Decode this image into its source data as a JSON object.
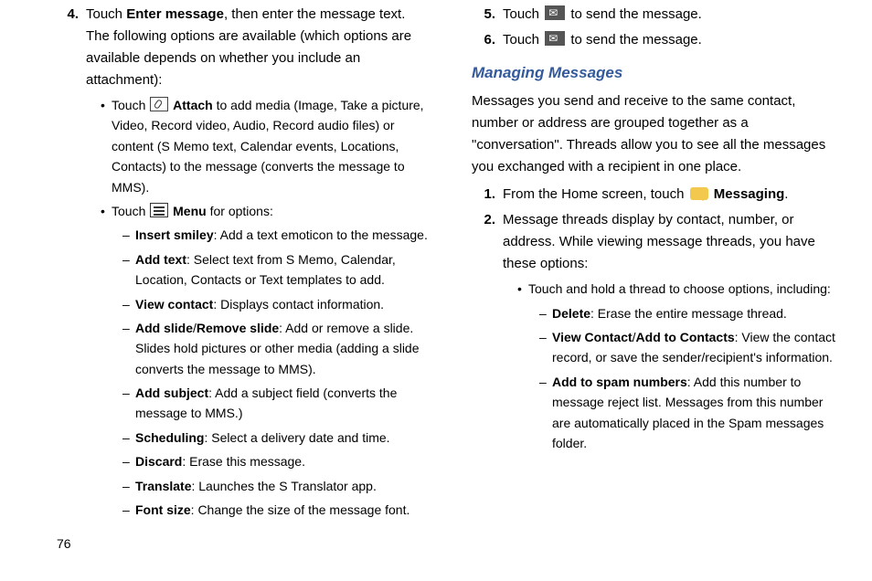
{
  "pageNumber": "76",
  "left": {
    "step4": {
      "num": "4.",
      "pre": "Touch ",
      "bold": "Enter message",
      "post": ", then enter the message text. The following options are available (which options are available depends on whether you include an attachment):"
    },
    "attach": {
      "pre": "Touch ",
      "bold": "Attach",
      "post": " to add media (Image, Take a picture, Video, Record video, Audio, Record audio files) or content (S Memo text, Calendar events, Locations, Contacts) to the message (converts the message to MMS)."
    },
    "menu": {
      "pre": "Touch ",
      "bold": "Menu",
      "post": " for options:"
    },
    "insertSmiley": {
      "bold": "Insert smiley",
      "post": ": Add a text emoticon to the message."
    },
    "addText": {
      "bold": "Add text",
      "post": ": Select text from S Memo, Calendar, Location, Contacts or Text templates to add."
    },
    "viewContact": {
      "bold": "View contact",
      "post": ": Displays contact information."
    },
    "addSlide": {
      "bold1": "Add slide",
      "sep": "/",
      "bold2": "Remove slide",
      "post": ": Add or remove a slide. Slides hold pictures or other media (adding a slide converts the message to MMS)."
    },
    "addSubject": {
      "bold": "Add subject",
      "post": ": Add a subject field (converts the message to MMS.)"
    },
    "scheduling": {
      "bold": "Scheduling",
      "post": ": Select a delivery date and time."
    },
    "discard": {
      "bold": "Discard",
      "post": ": Erase this message."
    },
    "translate": {
      "bold": "Translate",
      "post": ": Launches the S Translator app."
    },
    "fontSize": {
      "bold": "Font size",
      "post": ": Change the size of the message font."
    }
  },
  "right": {
    "step5": {
      "num": "5.",
      "pre": "Touch ",
      "post": " to send the message."
    },
    "step6": {
      "num": "6.",
      "pre": "Touch ",
      "post": " to send the message."
    },
    "heading": "Managing Messages",
    "intro": "Messages you send and receive to the same contact, number or address are grouped together as a \"conversation\". Threads allow you to see all the messages you exchanged with a recipient in one place.",
    "step1": {
      "num": "1.",
      "pre": "From the Home screen, touch ",
      "bold": "Messaging",
      "post": "."
    },
    "step2": {
      "num": "2.",
      "text": "Message threads display by contact, number, or address. While viewing message threads, you have these options:"
    },
    "hold": "Touch and hold a thread to choose options, including:",
    "delete": {
      "bold": "Delete",
      "post": ": Erase the entire message thread."
    },
    "viewAdd": {
      "bold1": "View Contact",
      "sep": "/",
      "bold2": "Add to Contacts",
      "post": ": View the contact record, or save the sender/recipient's information."
    },
    "spam": {
      "bold": "Add to spam numbers",
      "post": ": Add this number to message reject list. Messages from this number are automatically placed in the Spam messages folder."
    }
  }
}
